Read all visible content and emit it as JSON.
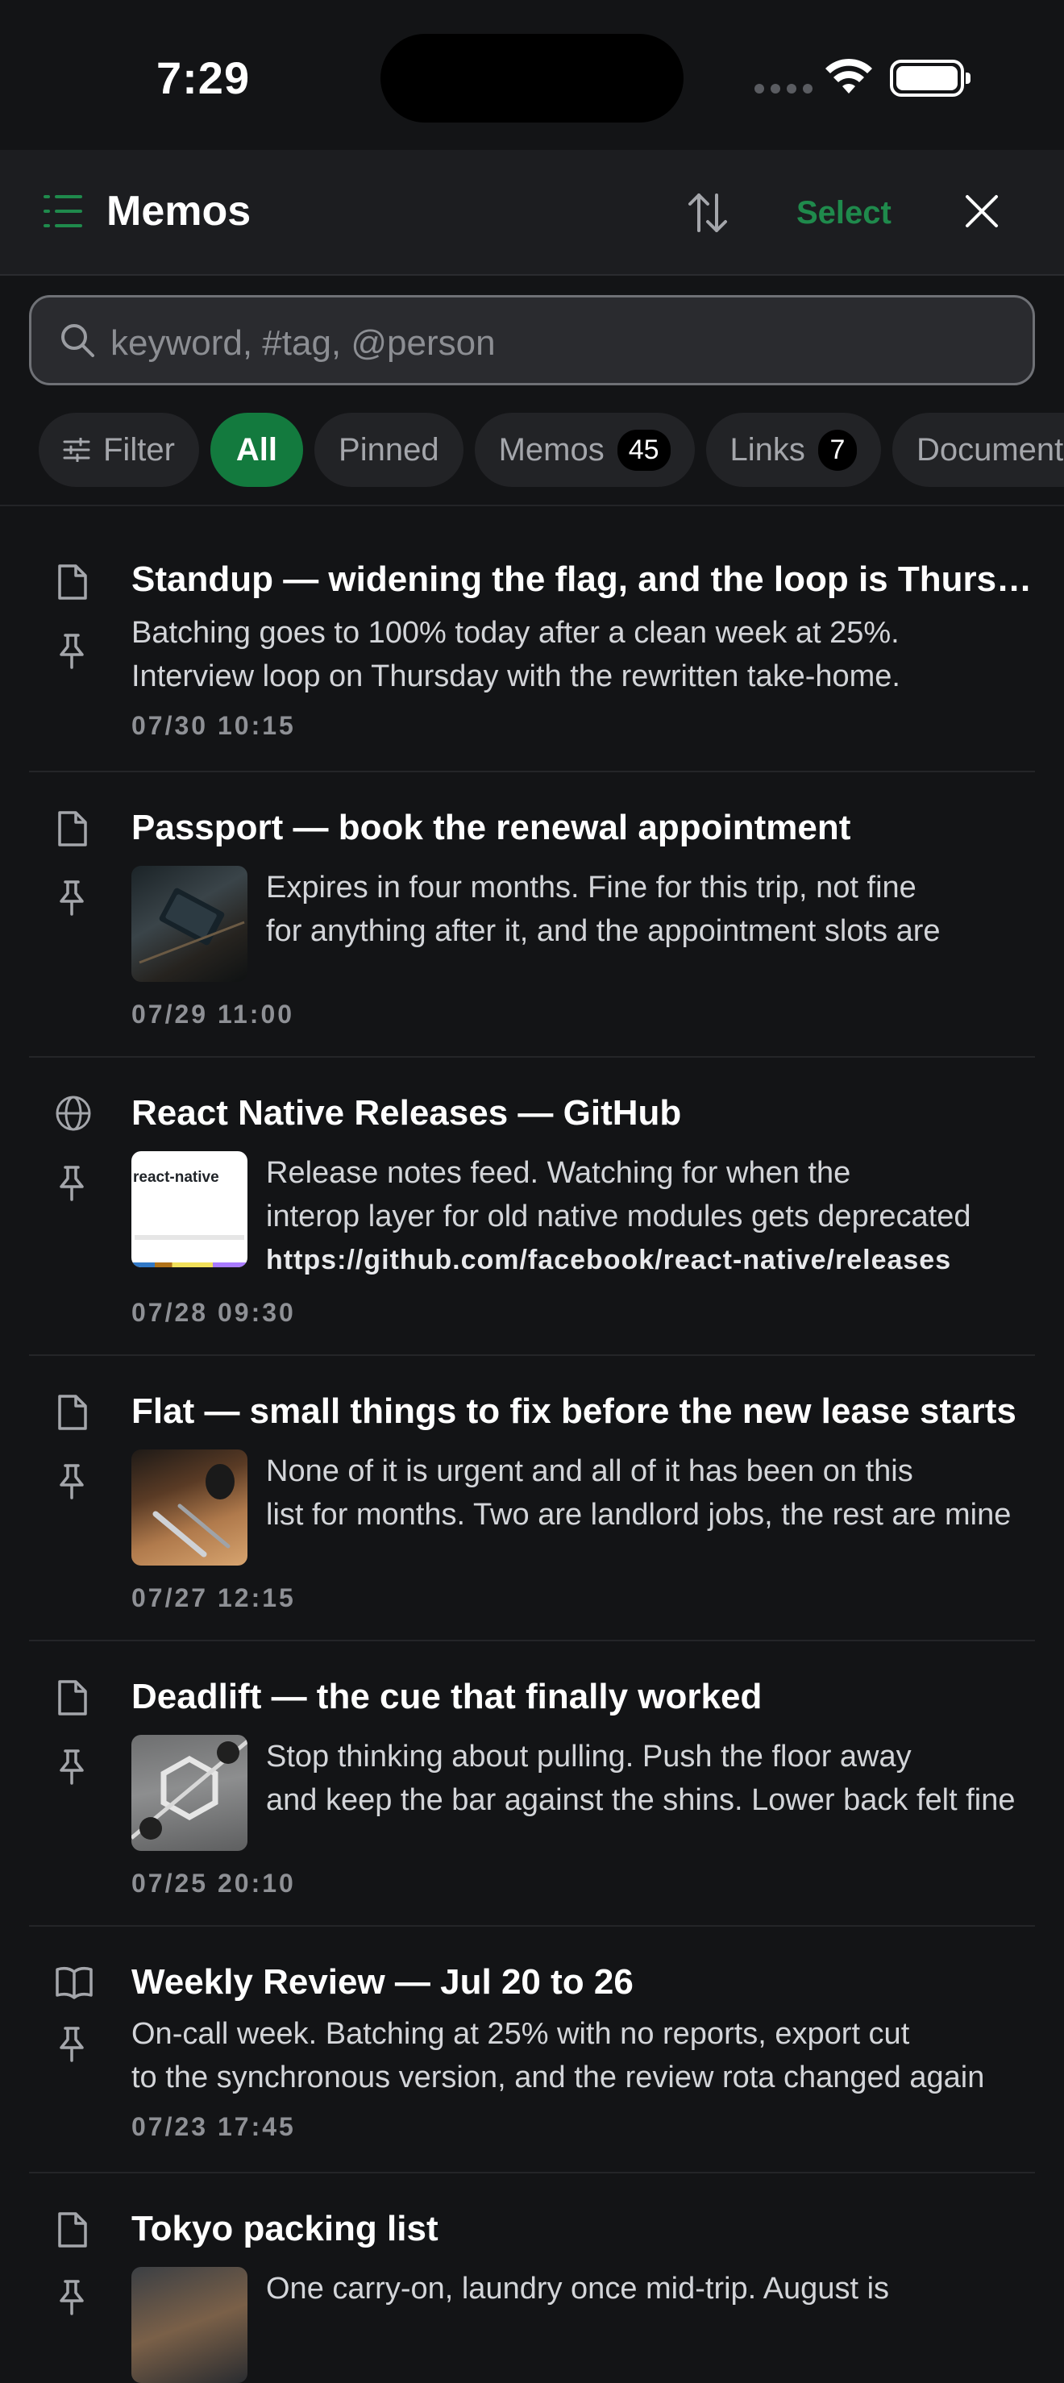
{
  "status_bar": {
    "time": "7:29"
  },
  "header": {
    "title": "Memos",
    "select_label": "Select"
  },
  "search": {
    "placeholder": "keyword, #tag, @person"
  },
  "chips": {
    "filter": "Filter",
    "all": "All",
    "pinned": "Pinned",
    "memos": "Memos",
    "memos_count": "45",
    "links": "Links",
    "links_count": "7",
    "documents": "Documents"
  },
  "memos": [
    {
      "icon": "document-icon",
      "title": "Standup — widening the flag, and the loop is Thursday",
      "lines": [
        "Batching goes to 100% today after a clean week at 25%.",
        "Interview loop on Thursday with the rewritten take-home."
      ],
      "date": "07/30 10:15"
    },
    {
      "icon": "document-icon",
      "title": "Passport — book the renewal appointment",
      "lines": [
        "Expires in four months. Fine for this trip, not fine",
        "for anything after it, and the appointment slots are"
      ],
      "date": "07/29 11:00",
      "thumb": "passport-photo"
    },
    {
      "icon": "globe-icon",
      "title": "React Native Releases — GitHub",
      "lines": [
        "Release notes feed. Watching for when the",
        "interop layer for old native modules gets deprecated"
      ],
      "url": "https://github.com/facebook/react-native/releases",
      "date": "07/28 09:30",
      "thumb_text": "react-native"
    },
    {
      "icon": "document-icon",
      "title": "Flat — small things to fix before the new lease starts",
      "lines": [
        "None of it is urgent and all of it has been on this",
        "list for months. Two are landlord jobs, the rest are mine"
      ],
      "date": "07/27 12:15",
      "thumb": "tools-photo"
    },
    {
      "icon": "document-icon",
      "title": "Deadlift — the cue that finally worked",
      "lines": [
        "Stop thinking about pulling. Push the floor away",
        "and keep the bar against the shins. Lower back felt fine"
      ],
      "date": "07/25 20:10",
      "thumb": "barbell-photo"
    },
    {
      "icon": "book-icon",
      "title": "Weekly Review — Jul 20 to 26",
      "lines": [
        "On-call week. Batching at 25% with no reports, export cut",
        "to the synchronous version, and the review rota changed again"
      ],
      "date": "07/23 17:45"
    },
    {
      "icon": "document-icon",
      "title": "Tokyo packing list",
      "lines": [
        "One carry-on, laundry once mid-trip. August is"
      ],
      "thumb": "luggage-photo"
    }
  ]
}
